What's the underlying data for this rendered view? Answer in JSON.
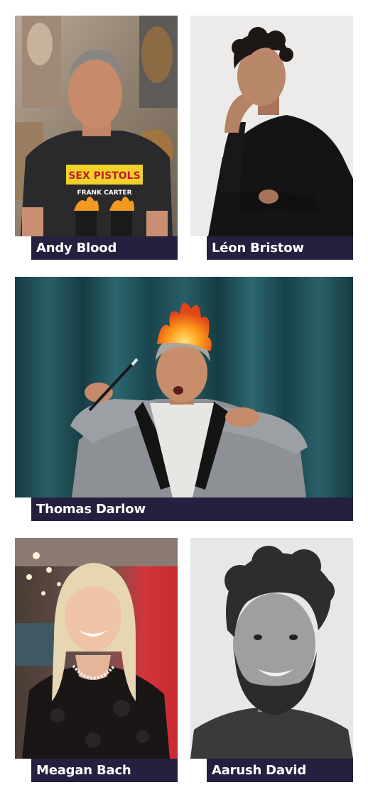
{
  "speakers": [
    {
      "name": "Andy Blood"
    },
    {
      "name": "Léon Bristow"
    },
    {
      "name": "Thomas Darlow"
    },
    {
      "name": "Meagan Bach"
    },
    {
      "name": "Aarush David"
    }
  ],
  "shirt_print": {
    "band": "SEX PISTOLS",
    "line": "FRANK CARTER"
  },
  "colors": {
    "name_plate_bg": "#23213f",
    "name_plate_text": "#ffffff",
    "curtain": "#1d4a52",
    "page_bg": "#ffffff"
  }
}
